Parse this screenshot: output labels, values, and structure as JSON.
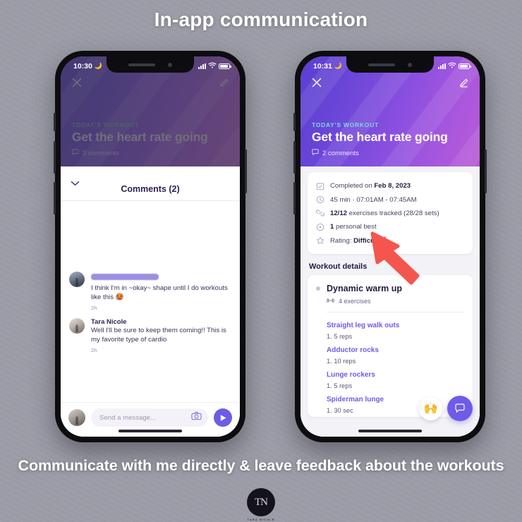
{
  "poster": {
    "headline": "In-app communication",
    "caption": "Communicate with me directly & leave feedback about the workouts",
    "logo_mark": "TN",
    "logo_sub": "TARA NICOLE"
  },
  "theme": {
    "accent": "#6c5ce7",
    "hero_gradient_start": "#5a3fd0",
    "hero_gradient_end": "#b95bd6",
    "label_mint": "#79dbd6",
    "arrow_red": "#f4564e"
  },
  "left_phone": {
    "status": {
      "time": "10:30",
      "moon_icon": "moon-icon",
      "signal_icon": "signal-bars-icon",
      "wifi_icon": "wifi-icon",
      "battery_icon": "battery-icon"
    },
    "hero": {
      "close_icon": "close-icon",
      "edit_icon": "pencil-edit-icon",
      "label": "TODAY'S WORKOUT",
      "title": "Get the heart rate going",
      "comment_icon": "comment-bubble-icon",
      "comments_count": "2 comments"
    },
    "sheet": {
      "chevron_icon": "chevron-down-icon",
      "title": "Comments (2)",
      "comments": [
        {
          "author": "",
          "author_redacted": true,
          "text": "I think I'm in ~okay~ shape until I do workouts like this 🥵",
          "time": "2h",
          "avatar": "user-avatar"
        },
        {
          "author": "Tara Nicole",
          "author_redacted": false,
          "text": "Well I'll be sure to keep them coming!! This is my favorite type of cardio",
          "time": "2h",
          "avatar": "user-avatar"
        }
      ],
      "composer": {
        "avatar": "current-user-avatar",
        "placeholder": "Send a message...",
        "camera_icon": "camera-icon",
        "send_icon": "send-arrow-icon"
      }
    }
  },
  "right_phone": {
    "status": {
      "time": "10:31",
      "moon_icon": "moon-icon",
      "signal_icon": "signal-bars-icon",
      "wifi_icon": "wifi-icon",
      "battery_icon": "battery-icon"
    },
    "hero": {
      "close_icon": "close-icon",
      "edit_icon": "pencil-edit-icon",
      "label": "TODAY'S WORKOUT",
      "title": "Get the heart rate going",
      "comment_icon": "comment-bubble-icon",
      "comments_count": "2 comments"
    },
    "summary": [
      {
        "icon": "calendar-check-icon",
        "prefix": "Completed on ",
        "strong": "Feb 8, 2023",
        "suffix": ""
      },
      {
        "icon": "clock-icon",
        "prefix": "",
        "strong": "",
        "suffix": "45 min · 07:01AM - 07:45AM"
      },
      {
        "icon": "link-chain-icon",
        "prefix": "",
        "strong": "12/12",
        "suffix": " exercises tracked (28/28 sets)"
      },
      {
        "icon": "target-icon",
        "prefix": "",
        "strong": "1",
        "suffix": " personal best"
      },
      {
        "icon": "star-icon",
        "prefix": "Rating: ",
        "strong": "Difficult",
        "suffix": " 🔥"
      }
    ],
    "details": {
      "section_title": "Workout details",
      "block_title": "Dynamic warm up",
      "block_meta_icon": "dumbbell-icon",
      "block_meta": "4 exercises",
      "exercises": [
        {
          "name": "Straight leg walk outs",
          "sets": "1. 5 reps"
        },
        {
          "name": "Adductor rocks",
          "sets": "1. 10 reps"
        },
        {
          "name": "Lunge rockers",
          "sets": "1. 5 reps"
        },
        {
          "name": "Spiderman lunge",
          "sets": "1. 30 sec"
        }
      ]
    },
    "fabs": {
      "emoji_label": "🙌",
      "emoji_name": "raising-hands-emoji-button",
      "chat_icon": "chat-bubble-icon"
    }
  }
}
